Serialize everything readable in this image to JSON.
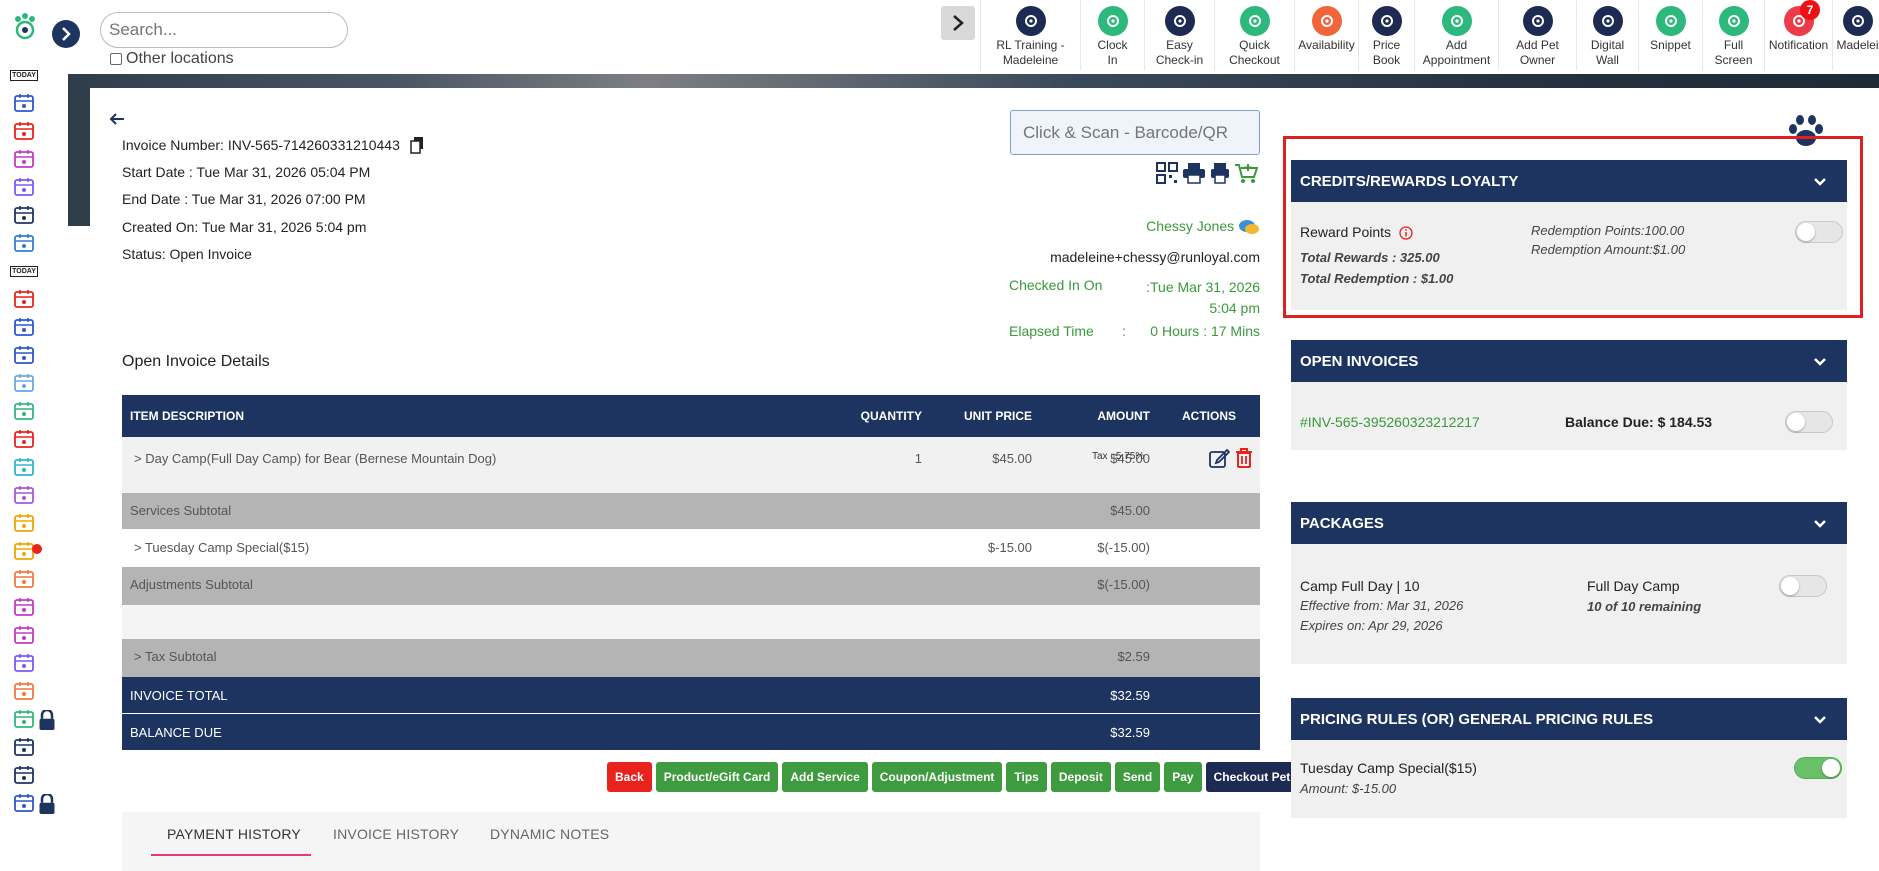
{
  "search": {
    "placeholder": "Search..."
  },
  "other_locations_label": "Other locations",
  "sidebar": {
    "items": [
      {
        "icon": "today-calendar-icon",
        "label": "TODAY"
      },
      {
        "icon": "dashboard-icon"
      },
      {
        "icon": "calendar-grid-icon"
      },
      {
        "icon": "dog-walker-icon"
      },
      {
        "icon": "kennel-icon"
      },
      {
        "icon": "checklist-icon"
      },
      {
        "icon": "location-pin-icon"
      },
      {
        "icon": "today-edit-icon",
        "label": "TODAY"
      },
      {
        "icon": "calendar-edit-icon"
      },
      {
        "icon": "calendar-icon"
      },
      {
        "icon": "calendar-alt-icon"
      },
      {
        "icon": "layout-icon"
      },
      {
        "icon": "clipboard-icon"
      },
      {
        "icon": "report-icon"
      },
      {
        "icon": "cart-icon"
      },
      {
        "icon": "dog-icon"
      },
      {
        "icon": "paw-icon"
      },
      {
        "icon": "target-icon"
      },
      {
        "icon": "user-icon"
      },
      {
        "icon": "chat-icon"
      },
      {
        "icon": "image-icon"
      },
      {
        "icon": "thumbs-up-icon"
      },
      {
        "icon": "rocket-icon"
      },
      {
        "icon": "analytics-icon"
      },
      {
        "icon": "time-settings-icon"
      },
      {
        "icon": "staff-icon"
      },
      {
        "icon": "tools-icon"
      }
    ]
  },
  "topnav": [
    {
      "label": "RL Training -\nMadeleine",
      "icon": "location-pin-icon",
      "color": "#1d2a52"
    },
    {
      "label": "Clock\nIn",
      "icon": "clock-icon",
      "color": "#2db87d"
    },
    {
      "label": "Easy\nCheck-in",
      "icon": "paw-icon",
      "color": "#1d2a52"
    },
    {
      "label": "Quick\nCheckout",
      "icon": "cart-icon",
      "color": "#2db87d"
    },
    {
      "label": "Availability",
      "icon": "calendar-icon",
      "color": "#f0653a"
    },
    {
      "label": "Price\nBook",
      "icon": "book-icon",
      "color": "#1d2a52"
    },
    {
      "label": "Add\nAppointment",
      "icon": "calendar-add-icon",
      "color": "#2db87d"
    },
    {
      "label": "Add Pet\nOwner",
      "icon": "add-user-icon",
      "color": "#1d2a52"
    },
    {
      "label": "Digital\nWall",
      "icon": "monitor-icon",
      "color": "#1d2a52"
    },
    {
      "label": "Snippet",
      "icon": "hash-icon",
      "color": "#2db87d"
    },
    {
      "label": "Full\nScreen",
      "icon": "expand-icon",
      "color": "#2db87d"
    },
    {
      "label": "Notification",
      "icon": "bell-icon",
      "color": "#ef3a4a",
      "badge": "7"
    },
    {
      "label": "Madelei",
      "icon": "user-icon",
      "color": "#1d2a52"
    }
  ],
  "invoice": {
    "number_label": "Invoice Number: INV-565-714260331210443",
    "start_date": "Start Date : Tue Mar 31, 2026 05:04 PM",
    "end_date": "End Date : Tue Mar 31, 2026 07:00 PM",
    "created_on": "Created On: Tue Mar 31, 2026 5:04 pm",
    "status": "Status: Open Invoice",
    "barcode_placeholder": "Click & Scan - Barcode/QR",
    "customer_name": "Chessy Jones",
    "customer_email": "madeleine+chessy@runloyal.com",
    "checked_in_label": "Checked In On",
    "checked_in_value": ":Tue Mar 31, 2026 5:04 pm",
    "elapsed_label": "Elapsed Time",
    "elapsed_colon": ":",
    "elapsed_value": "0 Hours : 17 Mins",
    "details_title": "Open Invoice Details"
  },
  "table": {
    "headers": {
      "desc": "ITEM DESCRIPTION",
      "qty": "QUANTITY",
      "unit": "UNIT PRICE",
      "amount": "AMOUNT",
      "actions": "ACTIONS"
    },
    "item": {
      "desc": ">  Day Camp(Full Day Camp) for Bear (Bernese Mountain Dog)",
      "qty": "1",
      "unit": "$45.00",
      "amount": "$45.00",
      "tax": "Tax : 5.75%"
    },
    "services_subtotal": {
      "label": "Services Subtotal",
      "amount": "$45.00"
    },
    "adjustment": {
      "desc": ">  Tuesday Camp Special($15)",
      "unit": "$-15.00",
      "amount": "$(-15.00)"
    },
    "adjustments_subtotal": {
      "label": "Adjustments Subtotal",
      "amount": "$(-15.00)"
    },
    "tax_subtotal": {
      "label": ">  Tax Subtotal",
      "amount": "$2.59"
    },
    "invoice_total": {
      "label": "INVOICE TOTAL",
      "amount": "$32.59"
    },
    "balance_due": {
      "label": "BALANCE DUE",
      "amount": "$32.59"
    }
  },
  "buttons": {
    "back": "Back",
    "product": "Product/eGift Card",
    "add_service": "Add Service",
    "coupon": "Coupon/Adjustment",
    "tips": "Tips",
    "deposit": "Deposit",
    "send": "Send",
    "pay": "Pay",
    "checkout": "Checkout Pet"
  },
  "tabs": [
    "PAYMENT HISTORY",
    "INVOICE HISTORY",
    "DYNAMIC NOTES"
  ],
  "panels": {
    "credits": {
      "title": "CREDITS/REWARDS LOYALTY",
      "reward_points": "Reward Points",
      "total_rewards": "Total Rewards : 325.00",
      "total_redemption": "Total Redemption : $1.00",
      "redemption_points": "Redemption Points:100.00",
      "redemption_amount": "Redemption Amount:$1.00"
    },
    "open_invoices": {
      "title": "OPEN INVOICES",
      "invoice_id": "#INV-565-395260323212217",
      "balance_due": "Balance Due: $ 184.53"
    },
    "packages": {
      "title": "PACKAGES",
      "name": "Camp Full Day | 10",
      "effective": "Effective from: Mar 31, 2026",
      "expires": "Expires on: Apr 29, 2026",
      "service": "Full Day Camp",
      "remaining": "10 of 10 remaining"
    },
    "pricing": {
      "title": "PRICING RULES (OR) GENERAL PRICING RULES",
      "rule": "Tuesday Camp Special($15)",
      "amount": "Amount: $-15.00"
    }
  },
  "colors": {
    "navy": "#1d3461",
    "green": "#3a9a3a",
    "red": "#e8221c",
    "highlight": "#e02020"
  }
}
